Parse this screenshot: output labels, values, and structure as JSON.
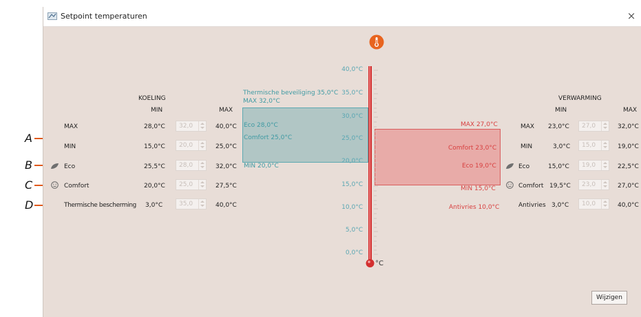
{
  "window": {
    "title": "Setpoint temperaturen",
    "close_glyph": "×"
  },
  "callouts": [
    "A",
    "B",
    "C",
    "D"
  ],
  "koeling": {
    "title": "KOELING",
    "col_min": "MIN",
    "col_max": "MAX",
    "rows": [
      {
        "label": "MAX",
        "value": "28,0°C",
        "input": "32,0",
        "max": "40,0°C"
      },
      {
        "label": "MIN",
        "value": "15,0°C",
        "input": "20,0",
        "max": "25,0°C"
      },
      {
        "label": "Eco",
        "value": "25,5°C",
        "input": "28,0",
        "max": "32,0°C"
      },
      {
        "label": "Comfort",
        "value": "20,0°C",
        "input": "25,0",
        "max": "27,5°C"
      },
      {
        "label": "Thermische bescherming",
        "value": "3,0°C",
        "input": "35,0",
        "max": "40,0°C"
      }
    ]
  },
  "verwarming": {
    "title": "VERWARMING",
    "col_min": "MIN",
    "col_max": "MAX",
    "rows": [
      {
        "label": "MAX",
        "value": "23,0°C",
        "input": "27,0",
        "max": "32,0°C"
      },
      {
        "label": "MIN",
        "value": "3,0°C",
        "input": "15,0",
        "max": "19,0°C"
      },
      {
        "label": "Eco",
        "value": "15,0°C",
        "input": "19,0",
        "max": "22,5°C"
      },
      {
        "label": "Comfort",
        "value": "19,5°C",
        "input": "23,0",
        "max": "27,0°C"
      },
      {
        "label": "Antivries",
        "value": "3,0°C",
        "input": "10,0",
        "max": "40,0°C"
      }
    ]
  },
  "thermometer": {
    "unit": "°C",
    "ticks": [
      "40,0°C",
      "35,0°C",
      "30,0°C",
      "25,0°C",
      "20,0°C",
      "15,0°C",
      "10,0°C",
      "5,0°C",
      "0,0°C"
    ],
    "cool_labels": {
      "protection": "Thermische beveiliging 35,0°C",
      "max": "MAX 32,0°C",
      "eco": "Eco 28,0°C",
      "comfort": "Comfort 25,0°C",
      "min": "MIN 20,0°C"
    },
    "heat_labels": {
      "max": "MAX 27,0°C",
      "comfort": "Comfort 23,0°C",
      "eco": "Eco 19,0°C",
      "min": "MIN 15,0°C",
      "antifreeze": "Antivries 10,0°C"
    }
  },
  "buttons": {
    "change": "Wijzigen"
  },
  "colors": {
    "accent": "#e05a1b",
    "cool": "#5ba8b0",
    "heat": "#d85d5d",
    "background": "#e8ddd7"
  }
}
